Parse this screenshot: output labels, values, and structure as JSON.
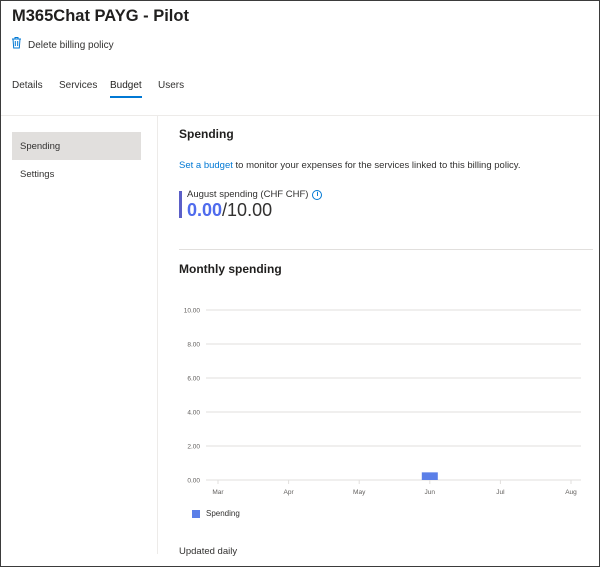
{
  "page": {
    "title": "M365Chat PAYG - Pilot"
  },
  "toolbar": {
    "delete_label": "Delete billing policy",
    "delete_icon": "trash-icon"
  },
  "tabs": [
    {
      "label": "Details",
      "active": false
    },
    {
      "label": "Services",
      "active": false
    },
    {
      "label": "Budget",
      "active": true
    },
    {
      "label": "Users",
      "active": false
    }
  ],
  "sidebar": {
    "items": [
      {
        "label": "Spending",
        "selected": true
      },
      {
        "label": "Settings",
        "selected": false
      }
    ]
  },
  "spending": {
    "heading": "Spending",
    "link_text": "Set a budget",
    "description_rest": " to monitor your expenses for the services linked to this billing policy.",
    "month_label": "August spending (CHF CHF)",
    "current": "0.00",
    "budget": "/10.00"
  },
  "monthly": {
    "heading": "Monthly spending",
    "footer": "Updated daily"
  },
  "chart_data": {
    "type": "bar",
    "categories": [
      "Mar",
      "Apr",
      "May",
      "Jun",
      "Jul",
      "Aug"
    ],
    "series": [
      {
        "name": "Spending",
        "values": [
          0,
          0,
          0,
          0.45,
          0,
          0
        ]
      }
    ],
    "y_ticks": [
      "0.00",
      "2.00",
      "4.00",
      "6.00",
      "8.00",
      "10.00"
    ],
    "ylim": [
      0,
      10
    ],
    "grid": true,
    "legend_position": "bottom-left",
    "colors": {
      "bar": "#5b7fe8",
      "grid": "#e1dfdd"
    }
  },
  "colors": {
    "accent": "#0078d4",
    "value": "#4f6bed",
    "indicator": "#5b5fc7"
  }
}
